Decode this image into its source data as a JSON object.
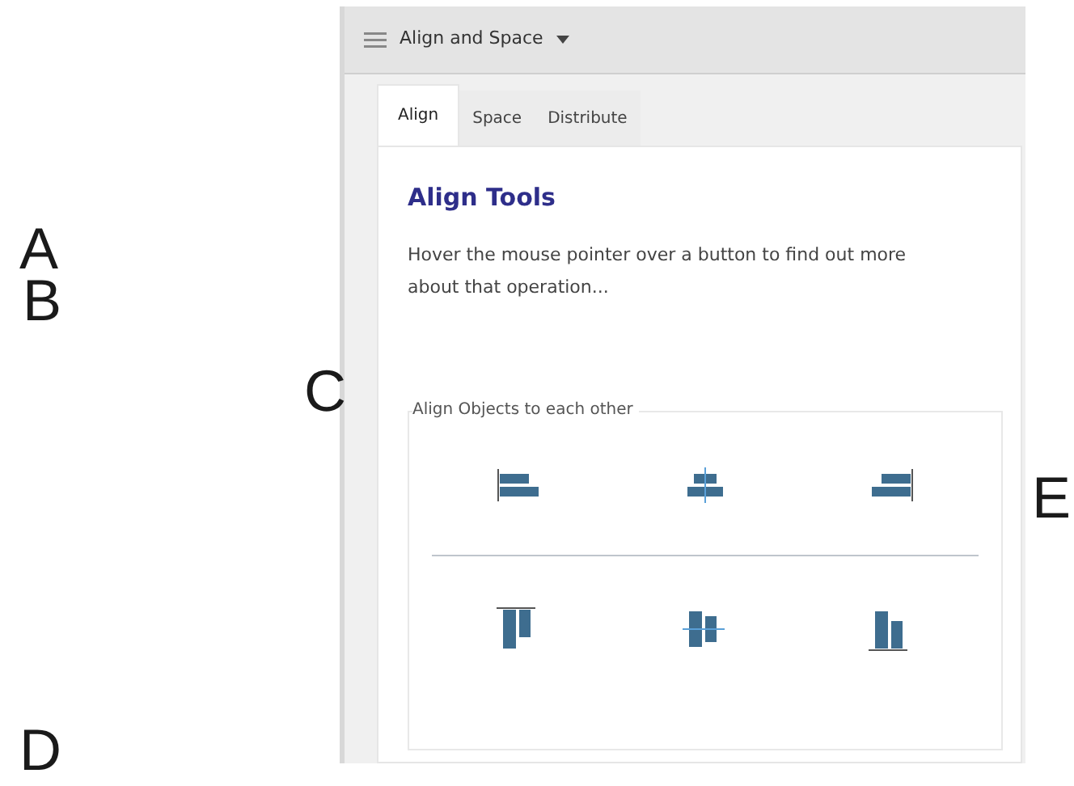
{
  "callouts": [
    "A",
    "B",
    "C",
    "D",
    "E"
  ],
  "panel": {
    "title": "Align and Space"
  },
  "tabs": [
    {
      "label": "Align",
      "selected": true
    },
    {
      "label": "Space",
      "selected": false
    },
    {
      "label": "Distribute",
      "selected": false
    }
  ],
  "heading": "Align Tools",
  "description": "Hover the mouse pointer over a button to find out more about that operation...",
  "group": {
    "legend": "Align Objects to each other"
  }
}
